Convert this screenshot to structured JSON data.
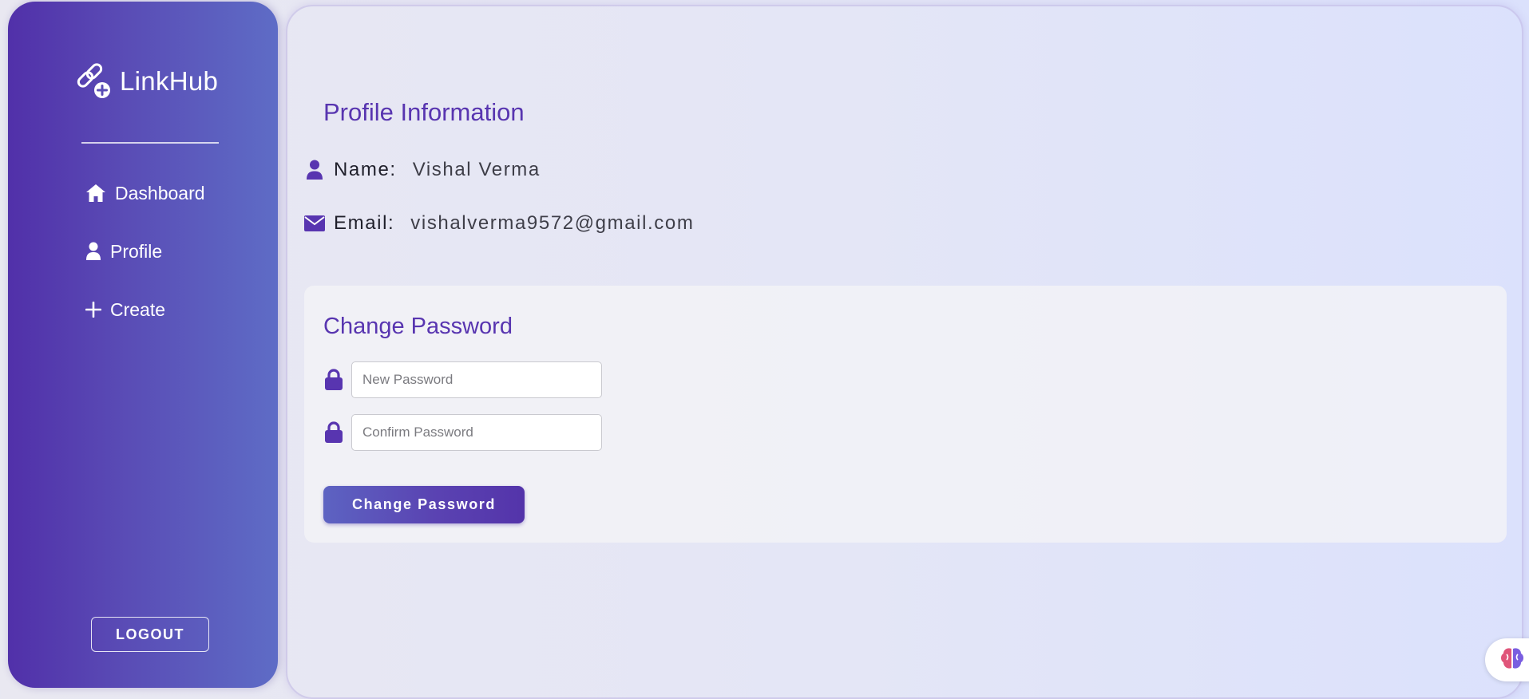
{
  "sidebar": {
    "brand": {
      "name": "LinkHub",
      "icon": "link-plus-icon"
    },
    "items": [
      {
        "label": "Dashboard",
        "icon": "home-icon"
      },
      {
        "label": "Profile",
        "icon": "user-icon"
      },
      {
        "label": "Create",
        "icon": "plus-icon"
      }
    ],
    "logout_label": "LOGOUT"
  },
  "profile": {
    "title": "Profile Information",
    "name_label": "Name:",
    "name_value": "Vishal Verma",
    "email_label": "Email:",
    "email_value": "vishalverma9572@gmail.com"
  },
  "change_password": {
    "title": "Change Password",
    "new_password_placeholder": "New Password",
    "confirm_password_placeholder": "Confirm Password",
    "submit_label": "Change Password"
  },
  "floating_widget": {
    "icon": "brain-icon"
  },
  "colors": {
    "accent": "#5835b0",
    "sidebar_start": "#5130a9",
    "sidebar_end": "#5e6cc6"
  }
}
